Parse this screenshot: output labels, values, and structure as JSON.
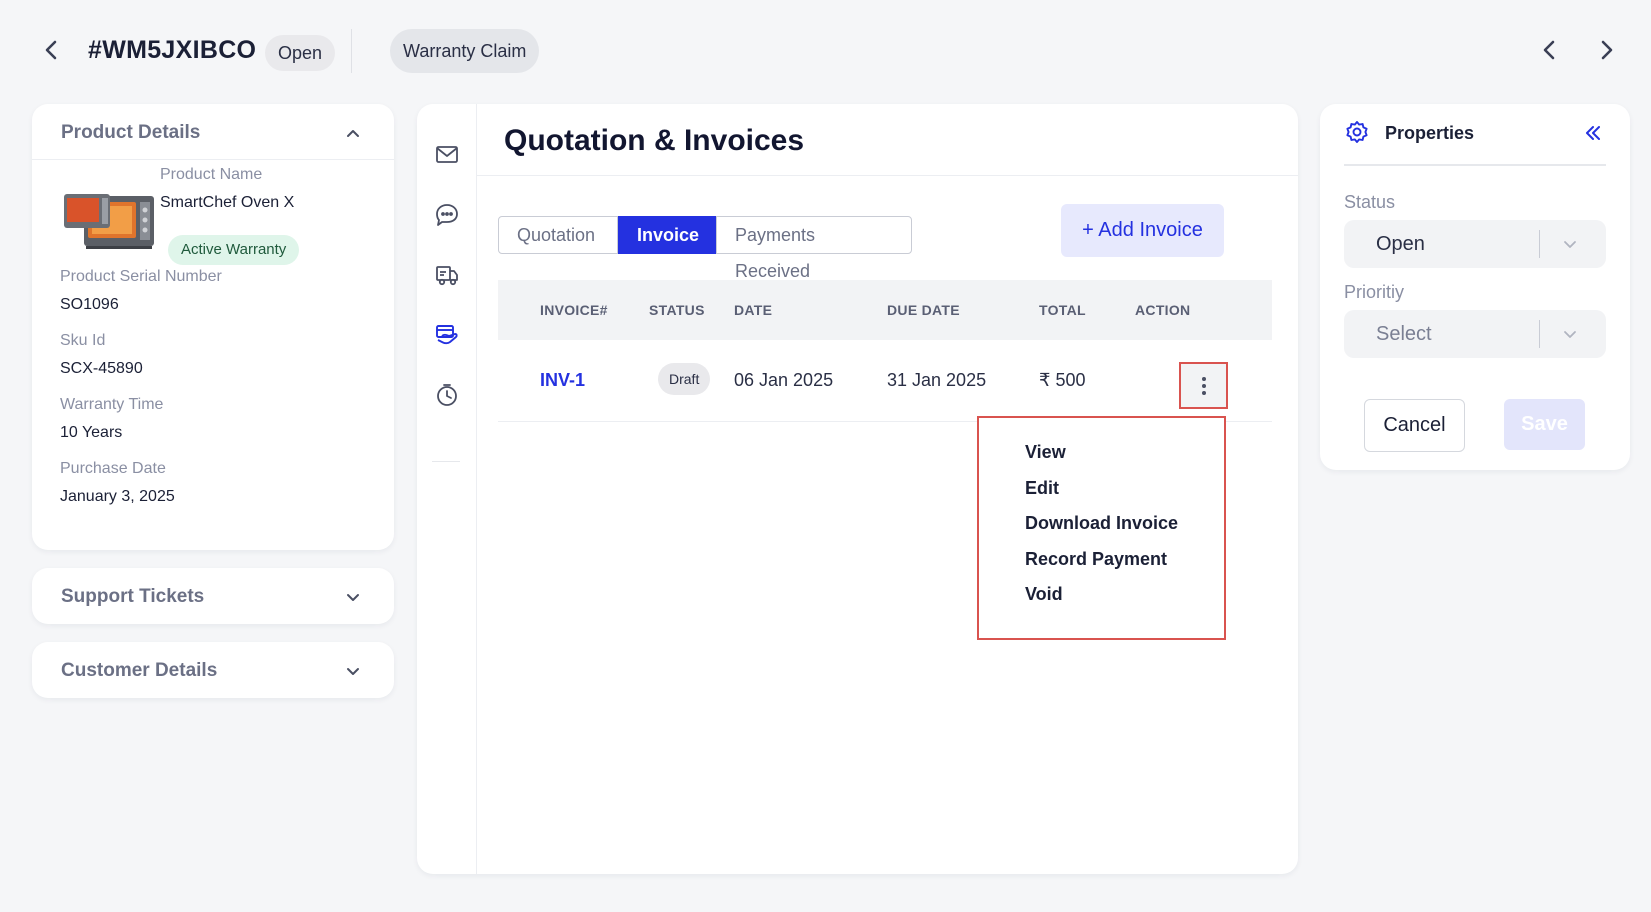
{
  "header": {
    "ticket_id": "#WM5JXIBCO",
    "status": "Open",
    "type": "Warranty Claim"
  },
  "product_details": {
    "title": "Product Details",
    "product_name_label": "Product Name",
    "product_name": "SmartChef Oven X",
    "warranty_badge": "Active Warranty",
    "serial_label": "Product Serial Number",
    "serial": "SO1096",
    "sku_label": "Sku Id",
    "sku": "SCX-45890",
    "warranty_time_label": "Warranty Time",
    "warranty_time": "10 Years",
    "purchase_date_label": "Purchase Date",
    "purchase_date": "January 3, 2025"
  },
  "support_tickets": {
    "title": "Support Tickets"
  },
  "customer_details": {
    "title": "Customer Details"
  },
  "main": {
    "title": "Quotation & Invoices",
    "tabs": [
      "Quotation",
      "Invoice",
      "Payments Received"
    ],
    "active_tab": "Invoice",
    "add_button": "+ Add Invoice",
    "columns": [
      "INVOICE#",
      "STATUS",
      "DATE",
      "DUE DATE",
      "TOTAL",
      "ACTION"
    ],
    "rows": [
      {
        "invoice": "INV-1",
        "status": "Draft",
        "date": "06 Jan 2025",
        "due_date": "31 Jan 2025",
        "total": "₹ 500"
      }
    ],
    "action_menu": [
      "View",
      "Edit",
      "Download Invoice",
      "Record Payment",
      "Void"
    ]
  },
  "properties": {
    "title": "Properties",
    "status_label": "Status",
    "status_value": "Open",
    "priority_label": "Prioritiy",
    "priority_value": "Select",
    "cancel_label": "Cancel",
    "save_label": "Save"
  },
  "colors": {
    "accent": "#2431e0",
    "highlight_border": "#d9534f",
    "badge_green_bg": "#dff5ea"
  },
  "icons": [
    "chevron-left-icon",
    "chevron-right-icon",
    "chevron-up-icon",
    "chevron-down-icon",
    "mail-icon",
    "chat-icon",
    "truck-icon",
    "payment-icon",
    "timer-icon",
    "gear-icon",
    "double-chevron-left-icon",
    "kebab-icon"
  ]
}
